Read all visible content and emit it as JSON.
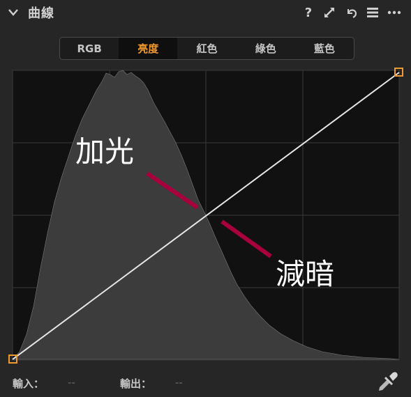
{
  "panel": {
    "title": "曲線",
    "header_icons": [
      "help-icon",
      "expand-icon",
      "reset-icon",
      "menu-icon",
      "more-icon"
    ],
    "help_glyph": "?"
  },
  "tabs": [
    {
      "label": "RGB",
      "active": false
    },
    {
      "label": "亮度",
      "active": true
    },
    {
      "label": "紅色",
      "active": false
    },
    {
      "label": "綠色",
      "active": false
    },
    {
      "label": "藍色",
      "active": false
    }
  ],
  "annotations": {
    "brighten": "加光",
    "darken": "減暗",
    "marker_color": "#a8003c"
  },
  "footer": {
    "input_label": "輸入：",
    "input_value": "--",
    "output_label": "輸出：",
    "output_value": "--"
  },
  "colors": {
    "accent": "#f0992e",
    "curve": "#e6e6e6",
    "histogram": "#3c3c3c",
    "grid": "#3a3a3a",
    "graph_bg": "#111111"
  }
}
